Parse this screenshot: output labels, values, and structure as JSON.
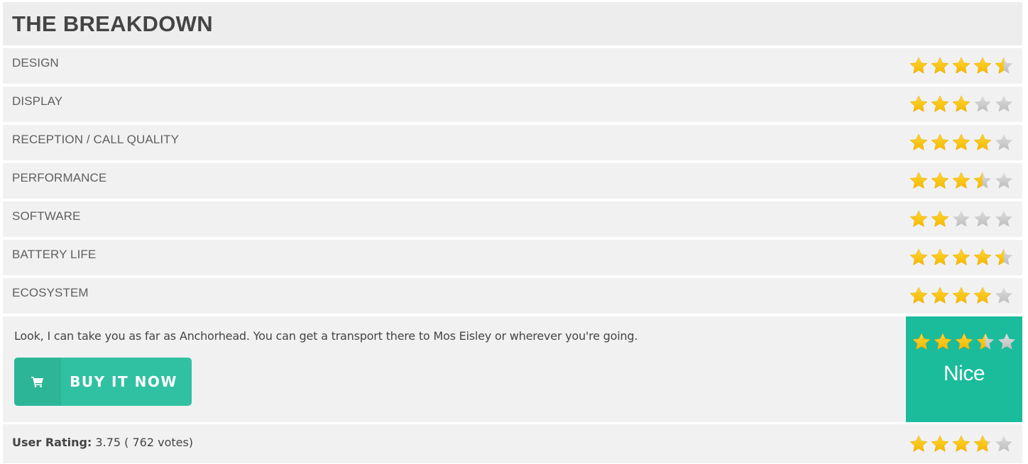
{
  "header": {
    "title": "THE BREAKDOWN"
  },
  "criteria": [
    {
      "label": "DESIGN",
      "rating": 4.5,
      "max": 5
    },
    {
      "label": "DISPLAY",
      "rating": 3,
      "max": 5
    },
    {
      "label": "RECEPTION / CALL QUALITY",
      "rating": 4,
      "max": 5
    },
    {
      "label": "PERFORMANCE",
      "rating": 3.5,
      "max": 5
    },
    {
      "label": "SOFTWARE",
      "rating": 2,
      "max": 5
    },
    {
      "label": "BATTERY LIFE",
      "rating": 4.5,
      "max": 5
    },
    {
      "label": "ECOSYSTEM",
      "rating": 4,
      "max": 5
    }
  ],
  "summary": {
    "text": "Look, I can take you as far as Anchorhead. You can get a transport there to Mos Eisley or wherever you're going.",
    "buy_button": {
      "label": "BUY IT NOW",
      "icon": "shopping-cart-icon"
    },
    "overall": {
      "rating": 3.5,
      "max": 5,
      "verdict": "Nice"
    }
  },
  "user_rating": {
    "label": "User Rating:",
    "value": "3.75",
    "votes_text": "( 762 votes)",
    "rating": 3.75,
    "max": 5
  },
  "colors": {
    "star_filled": "#ffc400",
    "star_empty": "#c9c9cc",
    "accent": "#1bbc9b",
    "button": "#30c1a3",
    "button_icon_bg": "#2cb597"
  }
}
